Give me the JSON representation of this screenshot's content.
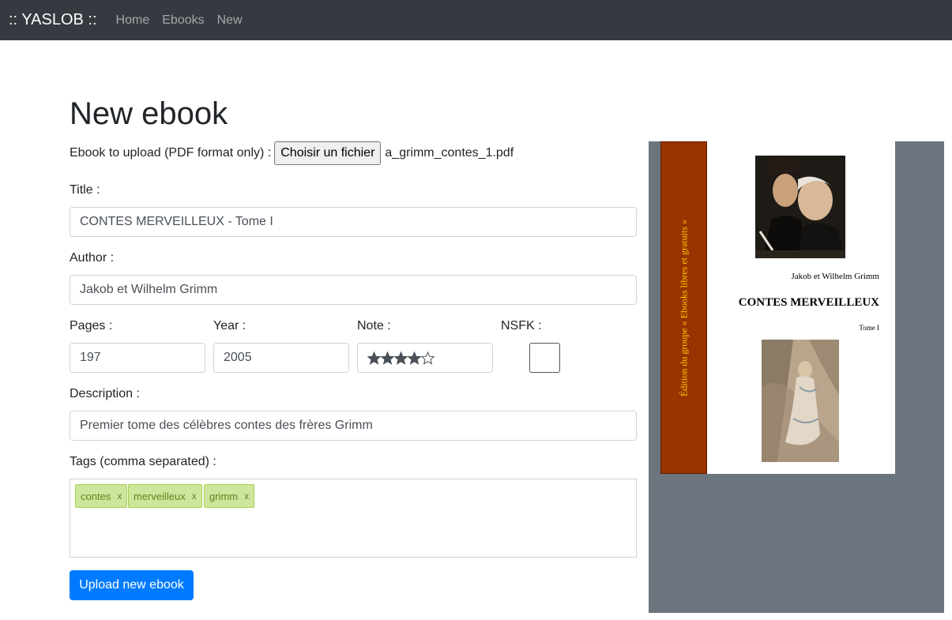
{
  "navbar": {
    "brand": ":: YASLOB ::",
    "links": [
      "Home",
      "Ebooks",
      "New"
    ]
  },
  "page": {
    "title": "New ebook"
  },
  "form": {
    "file_label": "Ebook to upload (PDF format only) :",
    "file_button": "Choisir un fichier",
    "file_name": "a_grimm_contes_1.pdf",
    "title_label": "Title :",
    "title_value": "CONTES MERVEILLEUX - Tome I",
    "author_label": "Author :",
    "author_value": "Jakob et Wilhelm Grimm",
    "pages_label": "Pages :",
    "pages_value": "197",
    "year_label": "Year :",
    "year_value": "2005",
    "note_label": "Note :",
    "note_rating": 4,
    "note_max": 5,
    "nsfk_label": "NSFK :",
    "nsfk_checked": false,
    "description_label": "Description :",
    "description_value": "Premier tome des célèbres contes des frères Grimm",
    "tags_label": "Tags (comma separated) :",
    "tags": [
      "contes",
      "merveilleux",
      "grimm"
    ],
    "tag_remove": "x",
    "submit_label": "Upload new ebook"
  },
  "cover": {
    "spine_text": "Édition du groupe « Ebooks libres et gratuits »",
    "author": "Jakob et Wilhelm Grimm",
    "title": "CONTES MERVEILLEUX",
    "tome": "Tome I"
  },
  "colors": {
    "navbar_bg": "#343a40",
    "primary": "#007bff",
    "tag_bg": "#cde69c",
    "tag_border": "#a5d24a",
    "preview_bg": "#6c757d",
    "spine": "#993300",
    "spine_text": "#ffcc00"
  }
}
